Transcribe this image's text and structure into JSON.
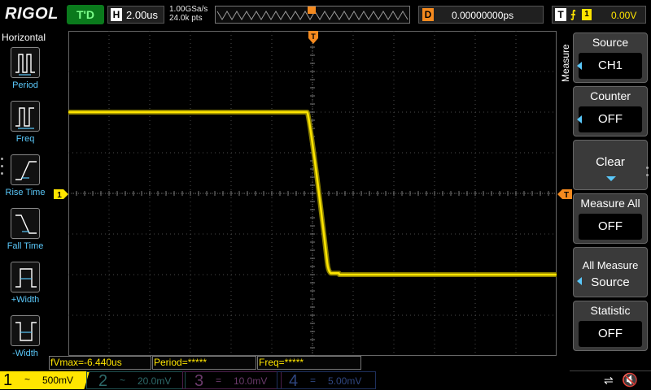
{
  "header": {
    "brand": "RIGOL",
    "run_status": "T'D",
    "horizontal": {
      "label": "H",
      "timebase": "2.00us"
    },
    "sample_rate": "1.00GSa/s",
    "memory_depth": "24.0k pts",
    "delay": {
      "label": "D",
      "value": "0.00000000ps"
    },
    "trigger": {
      "label": "T",
      "slope_symbol": "⨍",
      "source": "1",
      "level": "0.00V"
    }
  },
  "left_panel": {
    "title": "Horizontal",
    "items": [
      {
        "label": "Period",
        "icon": "period-icon"
      },
      {
        "label": "Freq",
        "icon": "freq-icon"
      },
      {
        "label": "Rise Time",
        "icon": "rise-time-icon"
      },
      {
        "label": "Fall Time",
        "icon": "fall-time-icon"
      },
      {
        "label": "+Width",
        "icon": "pos-width-icon"
      },
      {
        "label": "-Width",
        "icon": "neg-width-icon"
      }
    ]
  },
  "right_menu": {
    "title": "Measure",
    "source": {
      "label": "Source",
      "value": "CH1"
    },
    "counter": {
      "label": "Counter",
      "value": "OFF"
    },
    "clear": {
      "label": "Clear"
    },
    "measure_all": {
      "label": "Measure All",
      "value": "OFF"
    },
    "all_measure_source": {
      "line1": "All Measure",
      "line2": "Source"
    },
    "statistic": {
      "label": "Statistic",
      "value": "OFF"
    }
  },
  "measurements": [
    {
      "text": "fVmax=-6.440us"
    },
    {
      "text": "Period=*****"
    },
    {
      "text": "Freq=*****"
    }
  ],
  "channels": [
    {
      "num": "1",
      "coupling": "~",
      "scale": "500mV",
      "color": "#ffe500",
      "active": true
    },
    {
      "num": "2",
      "coupling": "~",
      "scale": "20.0mV",
      "color": "#2d6a6a",
      "active": false
    },
    {
      "num": "3",
      "coupling": "=",
      "scale": "10.0mV",
      "color": "#6b3a6b",
      "active": false
    },
    {
      "num": "4",
      "coupling": "=",
      "scale": "5.00mV",
      "color": "#2f4680",
      "active": false
    }
  ],
  "markers": {
    "trigger_position": "T",
    "ch1_offset": "1",
    "trigger_level": "T"
  },
  "status_icons": {
    "usb": "usb-icon",
    "speaker": "speaker-muted-icon"
  },
  "colors": {
    "ch1": "#ffe500",
    "trigger": "#f58a1f",
    "accent": "#5ac8fa",
    "run": "#0a7a1c"
  },
  "trace": {
    "description_units": "volts vs microseconds",
    "high_level_v": 1.0,
    "low_level_v": -1.0,
    "fall_start_us": -0.25,
    "fall_end_us": 0.9
  }
}
